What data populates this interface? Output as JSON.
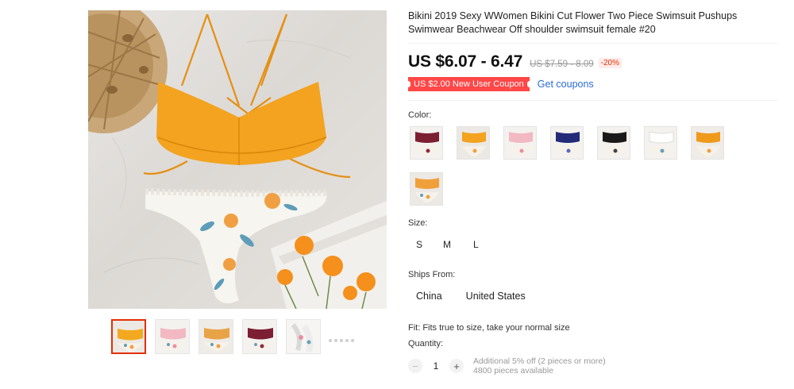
{
  "product": {
    "title": "Bikini 2019 Sexy WWomen Bikini Cut Flower Two Piece Swimsuit Pushups Swimwear Beachwear Off shoulder swimsuit female #20",
    "price": "US $6.07 - 6.47",
    "original_price": "US $7.59 - 8.09",
    "discount": "-20%",
    "coupon_label": "US $2.00 New User Coupon",
    "get_coupons_label": "Get coupons"
  },
  "gallery": {
    "thumbnails": [
      {
        "name": "thumb-orange-floral",
        "top": "#f3a91f",
        "bottom": "#f6f2ea",
        "active": true
      },
      {
        "name": "thumb-pink-floral",
        "top": "#f2b9c3",
        "bottom": "#f6f2ea",
        "active": false
      },
      {
        "name": "thumb-orange-floral-2",
        "top": "#e8a347",
        "bottom": "#f6f2ea",
        "active": false
      },
      {
        "name": "thumb-burgundy-floral",
        "top": "#7d1f33",
        "bottom": "#f6f2ea",
        "active": false
      },
      {
        "name": "thumb-white-floral",
        "top": "#f3f1ee",
        "bottom": "#f6f2ea",
        "active": false
      }
    ]
  },
  "colors": {
    "label": "Color:",
    "swatches": [
      {
        "name": "burgundy",
        "top": "#7d1f33"
      },
      {
        "name": "orange",
        "top": "#f3a31f"
      },
      {
        "name": "pink",
        "top": "#f2b9c3"
      },
      {
        "name": "navy",
        "top": "#232a78"
      },
      {
        "name": "black",
        "top": "#1a1a1a"
      },
      {
        "name": "white",
        "top": "#f5f5f5"
      },
      {
        "name": "orange-lace",
        "top": "#f09a1c"
      },
      {
        "name": "orange-print",
        "top": "#f0a03a"
      }
    ]
  },
  "sizes": {
    "label": "Size:",
    "options": [
      "S",
      "M",
      "L"
    ]
  },
  "ships": {
    "label": "Ships From:",
    "options": [
      "China",
      "United States"
    ]
  },
  "fit": "Fit: Fits true to size, take your normal size",
  "quantity": {
    "label": "Quantity:",
    "value": "1",
    "minus": "−",
    "plus": "+",
    "offer": "Additional 5% off (2 pieces or more)",
    "available": "4800 pieces available"
  },
  "accent_colors": {
    "price_red": "#e62e04",
    "coupon_red": "#ff4747",
    "link_blue": "#2a6bd6",
    "bikini_orange": "#f3a31f"
  }
}
